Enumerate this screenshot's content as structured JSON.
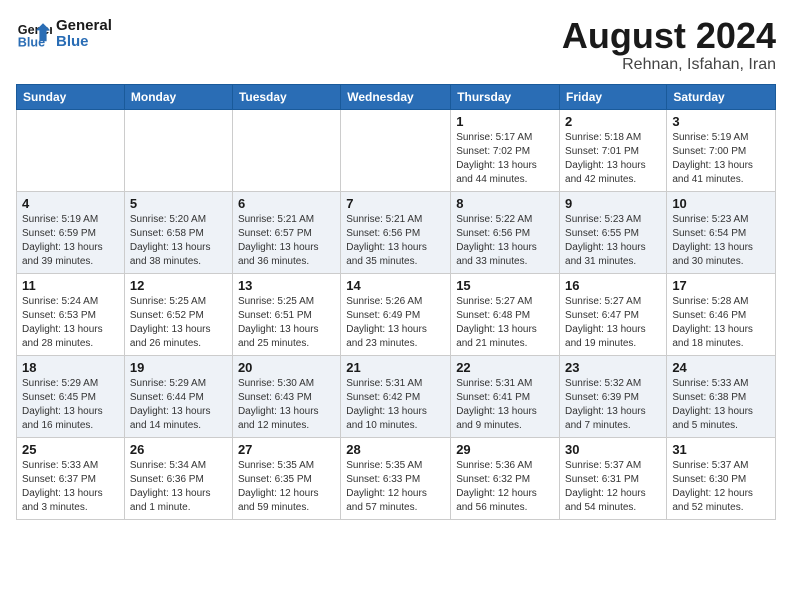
{
  "header": {
    "logo_line1": "General",
    "logo_line2": "Blue",
    "month_year": "August 2024",
    "location": "Rehnan, Isfahan, Iran"
  },
  "days_of_week": [
    "Sunday",
    "Monday",
    "Tuesday",
    "Wednesday",
    "Thursday",
    "Friday",
    "Saturday"
  ],
  "weeks": [
    [
      {
        "day": "",
        "info": ""
      },
      {
        "day": "",
        "info": ""
      },
      {
        "day": "",
        "info": ""
      },
      {
        "day": "",
        "info": ""
      },
      {
        "day": "1",
        "info": "Sunrise: 5:17 AM\nSunset: 7:02 PM\nDaylight: 13 hours\nand 44 minutes."
      },
      {
        "day": "2",
        "info": "Sunrise: 5:18 AM\nSunset: 7:01 PM\nDaylight: 13 hours\nand 42 minutes."
      },
      {
        "day": "3",
        "info": "Sunrise: 5:19 AM\nSunset: 7:00 PM\nDaylight: 13 hours\nand 41 minutes."
      }
    ],
    [
      {
        "day": "4",
        "info": "Sunrise: 5:19 AM\nSunset: 6:59 PM\nDaylight: 13 hours\nand 39 minutes."
      },
      {
        "day": "5",
        "info": "Sunrise: 5:20 AM\nSunset: 6:58 PM\nDaylight: 13 hours\nand 38 minutes."
      },
      {
        "day": "6",
        "info": "Sunrise: 5:21 AM\nSunset: 6:57 PM\nDaylight: 13 hours\nand 36 minutes."
      },
      {
        "day": "7",
        "info": "Sunrise: 5:21 AM\nSunset: 6:56 PM\nDaylight: 13 hours\nand 35 minutes."
      },
      {
        "day": "8",
        "info": "Sunrise: 5:22 AM\nSunset: 6:56 PM\nDaylight: 13 hours\nand 33 minutes."
      },
      {
        "day": "9",
        "info": "Sunrise: 5:23 AM\nSunset: 6:55 PM\nDaylight: 13 hours\nand 31 minutes."
      },
      {
        "day": "10",
        "info": "Sunrise: 5:23 AM\nSunset: 6:54 PM\nDaylight: 13 hours\nand 30 minutes."
      }
    ],
    [
      {
        "day": "11",
        "info": "Sunrise: 5:24 AM\nSunset: 6:53 PM\nDaylight: 13 hours\nand 28 minutes."
      },
      {
        "day": "12",
        "info": "Sunrise: 5:25 AM\nSunset: 6:52 PM\nDaylight: 13 hours\nand 26 minutes."
      },
      {
        "day": "13",
        "info": "Sunrise: 5:25 AM\nSunset: 6:51 PM\nDaylight: 13 hours\nand 25 minutes."
      },
      {
        "day": "14",
        "info": "Sunrise: 5:26 AM\nSunset: 6:49 PM\nDaylight: 13 hours\nand 23 minutes."
      },
      {
        "day": "15",
        "info": "Sunrise: 5:27 AM\nSunset: 6:48 PM\nDaylight: 13 hours\nand 21 minutes."
      },
      {
        "day": "16",
        "info": "Sunrise: 5:27 AM\nSunset: 6:47 PM\nDaylight: 13 hours\nand 19 minutes."
      },
      {
        "day": "17",
        "info": "Sunrise: 5:28 AM\nSunset: 6:46 PM\nDaylight: 13 hours\nand 18 minutes."
      }
    ],
    [
      {
        "day": "18",
        "info": "Sunrise: 5:29 AM\nSunset: 6:45 PM\nDaylight: 13 hours\nand 16 minutes."
      },
      {
        "day": "19",
        "info": "Sunrise: 5:29 AM\nSunset: 6:44 PM\nDaylight: 13 hours\nand 14 minutes."
      },
      {
        "day": "20",
        "info": "Sunrise: 5:30 AM\nSunset: 6:43 PM\nDaylight: 13 hours\nand 12 minutes."
      },
      {
        "day": "21",
        "info": "Sunrise: 5:31 AM\nSunset: 6:42 PM\nDaylight: 13 hours\nand 10 minutes."
      },
      {
        "day": "22",
        "info": "Sunrise: 5:31 AM\nSunset: 6:41 PM\nDaylight: 13 hours\nand 9 minutes."
      },
      {
        "day": "23",
        "info": "Sunrise: 5:32 AM\nSunset: 6:39 PM\nDaylight: 13 hours\nand 7 minutes."
      },
      {
        "day": "24",
        "info": "Sunrise: 5:33 AM\nSunset: 6:38 PM\nDaylight: 13 hours\nand 5 minutes."
      }
    ],
    [
      {
        "day": "25",
        "info": "Sunrise: 5:33 AM\nSunset: 6:37 PM\nDaylight: 13 hours\nand 3 minutes."
      },
      {
        "day": "26",
        "info": "Sunrise: 5:34 AM\nSunset: 6:36 PM\nDaylight: 13 hours\nand 1 minute."
      },
      {
        "day": "27",
        "info": "Sunrise: 5:35 AM\nSunset: 6:35 PM\nDaylight: 12 hours\nand 59 minutes."
      },
      {
        "day": "28",
        "info": "Sunrise: 5:35 AM\nSunset: 6:33 PM\nDaylight: 12 hours\nand 57 minutes."
      },
      {
        "day": "29",
        "info": "Sunrise: 5:36 AM\nSunset: 6:32 PM\nDaylight: 12 hours\nand 56 minutes."
      },
      {
        "day": "30",
        "info": "Sunrise: 5:37 AM\nSunset: 6:31 PM\nDaylight: 12 hours\nand 54 minutes."
      },
      {
        "day": "31",
        "info": "Sunrise: 5:37 AM\nSunset: 6:30 PM\nDaylight: 12 hours\nand 52 minutes."
      }
    ]
  ]
}
